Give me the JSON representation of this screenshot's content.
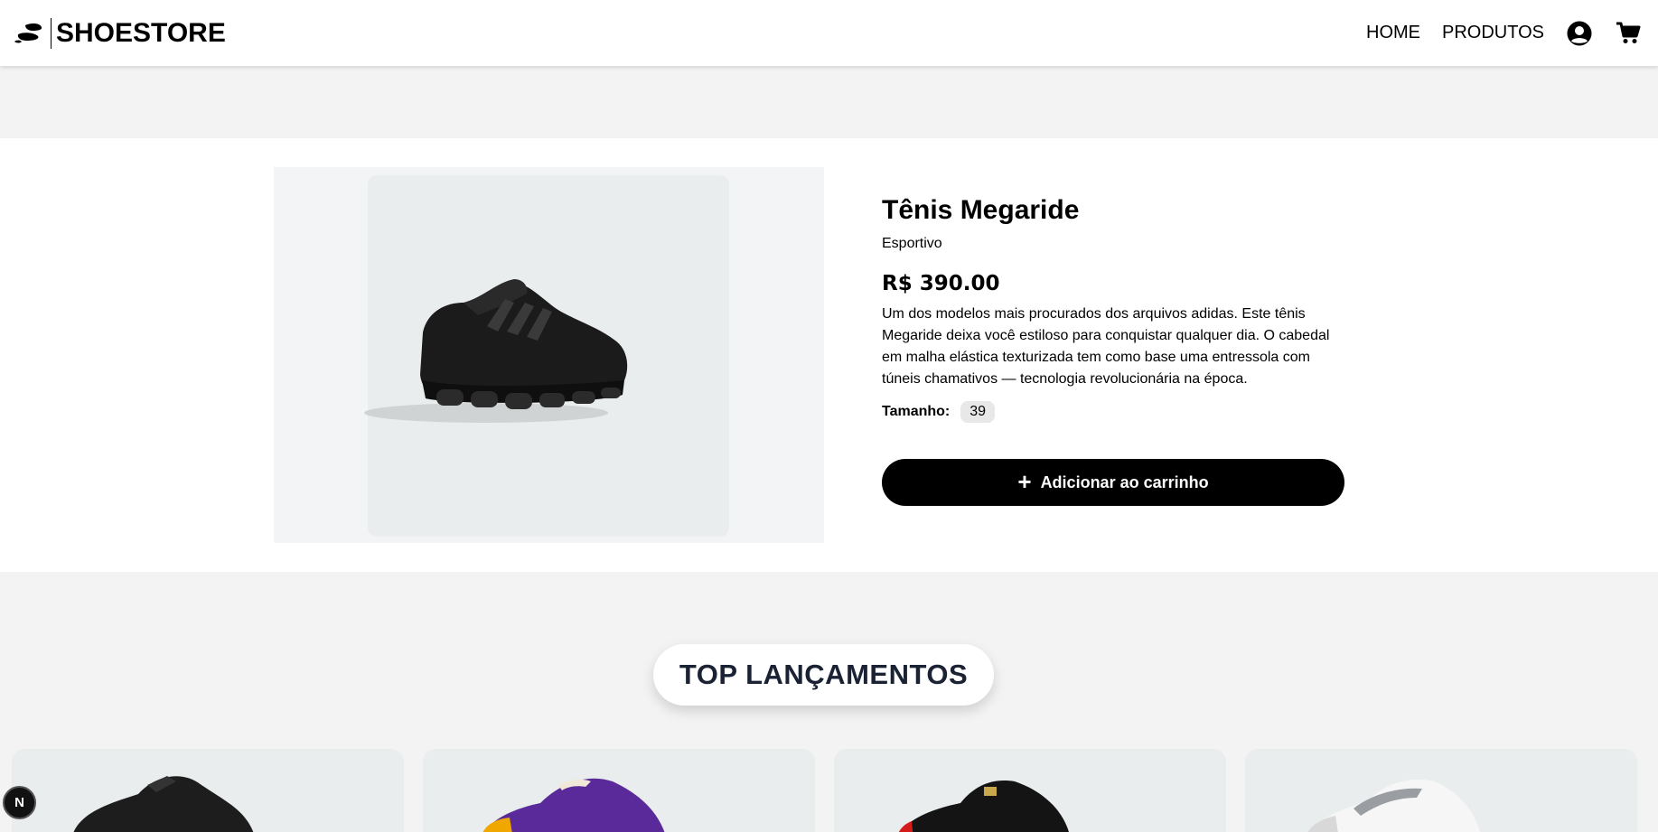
{
  "header": {
    "brand": "SHOESTORE",
    "nav": {
      "home": "HOME",
      "products": "PRODUTOS"
    }
  },
  "product": {
    "title": "Tênis Megaride",
    "category": "Esportivo",
    "price": "R$ 390.00",
    "description": "Um dos modelos mais procurados dos arquivos adidas. Este tênis Megaride deixa você estiloso para conquistar qualquer dia. O cabedal em malha elástica texturizada tem como base uma entressola com túneis chamativos — tecnologia revolucionária na época.",
    "size_label": "Tamanho:",
    "size_value": "39",
    "add_to_cart": "Adicionar ao carrinho"
  },
  "launches": {
    "title": "TOP LANÇAMENTOS"
  },
  "colors": {
    "accent": "#000000",
    "card_bg": "#e9edee",
    "heading": "#1a2233"
  },
  "icons": [
    "shoe-logo-icon",
    "user-circle-icon",
    "cart-icon",
    "plus-icon"
  ],
  "dev_badge": "N"
}
